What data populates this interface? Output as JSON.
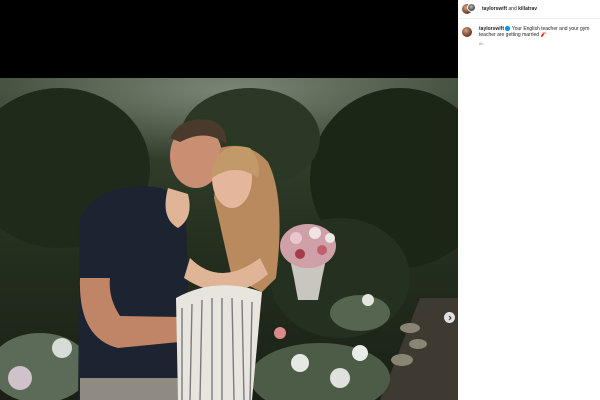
{
  "post": {
    "header": {
      "user_primary": "taylorswift",
      "joiner": " and ",
      "user_secondary": "killatrav"
    },
    "caption": {
      "username": "taylorswift",
      "verified_icon": "verified-badge-icon",
      "text": "Your English teacher and your gym teacher are getting married",
      "emoji": "🧨",
      "timestamp": "6h"
    },
    "media": {
      "next_icon": "chevron-right-icon"
    }
  },
  "colors": {
    "panel_background": "#ffffff",
    "media_background": "#000000",
    "verified": "#0095f6",
    "text": "#262626",
    "muted": "#8e8e8e"
  }
}
